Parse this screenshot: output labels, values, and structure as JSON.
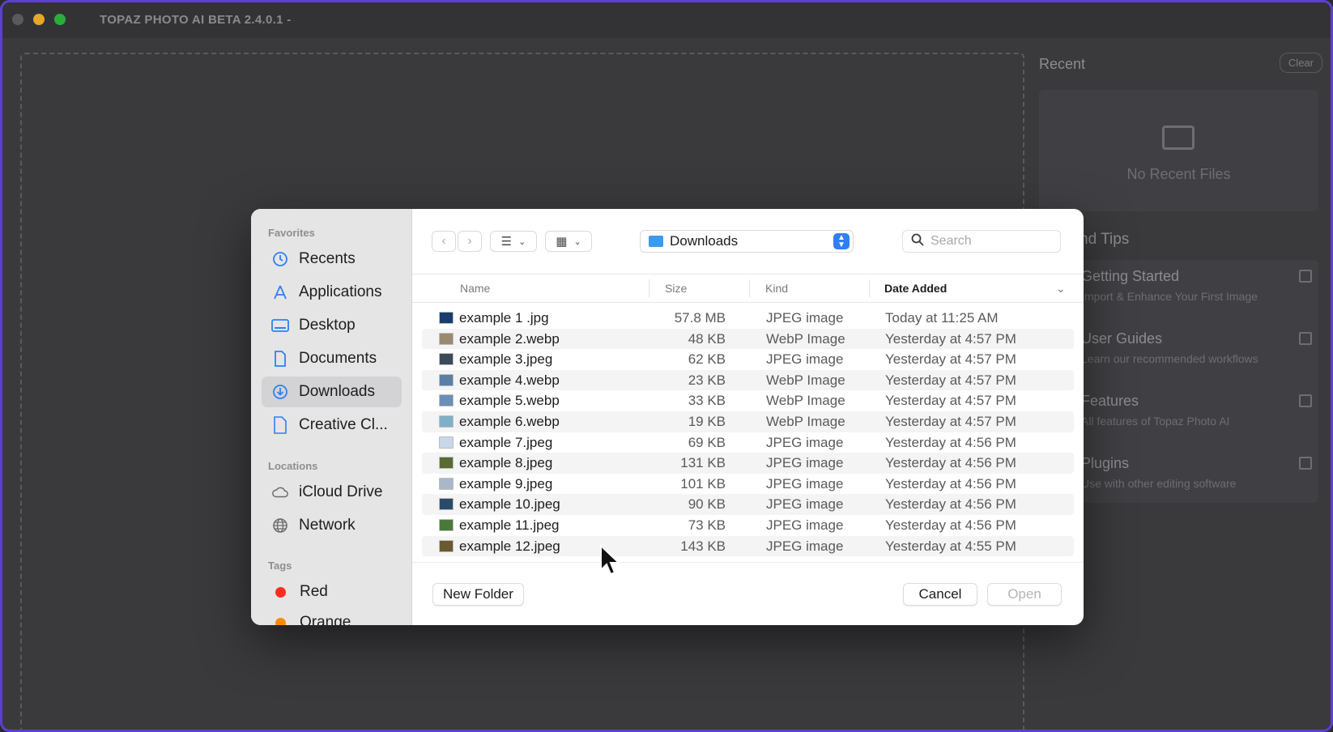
{
  "app": {
    "title": "TOPAZ PHOTO AI BETA 2.4.0.1 -",
    "recent": {
      "title": "Recent",
      "clear_label": "Clear",
      "empty_text": "No Recent Files"
    },
    "tips": {
      "title": "nd Tips",
      "items": [
        {
          "title": "Getting Started",
          "subtitle": "Import & Enhance Your First Image"
        },
        {
          "title": "User Guides",
          "subtitle": "Learn our recommended workflows"
        },
        {
          "title": "Features",
          "subtitle": "All features of Topaz Photo AI"
        },
        {
          "title": "Plugins",
          "subtitle": "Use with other editing software"
        }
      ]
    }
  },
  "dialog": {
    "sidebar": {
      "favorites_label": "Favorites",
      "favorites": [
        {
          "label": "Recents",
          "icon": "clock-icon"
        },
        {
          "label": "Applications",
          "icon": "applications-icon"
        },
        {
          "label": "Desktop",
          "icon": "desktop-icon"
        },
        {
          "label": "Documents",
          "icon": "document-icon"
        },
        {
          "label": "Downloads",
          "icon": "download-icon",
          "active": true
        },
        {
          "label": "Creative Cl...",
          "icon": "file-icon"
        }
      ],
      "locations_label": "Locations",
      "locations": [
        {
          "label": "iCloud Drive",
          "icon": "cloud-icon"
        },
        {
          "label": "Network",
          "icon": "globe-icon"
        }
      ],
      "tags_label": "Tags",
      "tags": [
        {
          "label": "Red",
          "color": "#ff2d20"
        },
        {
          "label": "Orange",
          "color": "#ff8a00"
        }
      ]
    },
    "toolbar": {
      "location": "Downloads",
      "search_placeholder": "Search"
    },
    "columns": {
      "name": "Name",
      "size": "Size",
      "kind": "Kind",
      "date": "Date Added"
    },
    "files": [
      {
        "name": "example 1 .jpg",
        "size": "57.8 MB",
        "kind": "JPEG image",
        "date": "Today at 11:25 AM"
      },
      {
        "name": "example 2.webp",
        "size": "48 KB",
        "kind": "WebP Image",
        "date": "Yesterday at 4:57 PM"
      },
      {
        "name": "example 3.jpeg",
        "size": "62 KB",
        "kind": "JPEG image",
        "date": "Yesterday at 4:57 PM"
      },
      {
        "name": "example 4.webp",
        "size": "23 KB",
        "kind": "WebP Image",
        "date": "Yesterday at 4:57 PM"
      },
      {
        "name": "example 5.webp",
        "size": "33 KB",
        "kind": "WebP Image",
        "date": "Yesterday at 4:57 PM"
      },
      {
        "name": "example 6.webp",
        "size": "19 KB",
        "kind": "WebP Image",
        "date": "Yesterday at 4:57 PM"
      },
      {
        "name": "example 7.jpeg",
        "size": "69 KB",
        "kind": "JPEG image",
        "date": "Yesterday at 4:56 PM"
      },
      {
        "name": "example 8.jpeg",
        "size": "131 KB",
        "kind": "JPEG image",
        "date": "Yesterday at 4:56 PM"
      },
      {
        "name": "example 9.jpeg",
        "size": "101 KB",
        "kind": "JPEG image",
        "date": "Yesterday at 4:56 PM"
      },
      {
        "name": "example 10.jpeg",
        "size": "90 KB",
        "kind": "JPEG image",
        "date": "Yesterday at 4:56 PM"
      },
      {
        "name": "example 11.jpeg",
        "size": "73 KB",
        "kind": "JPEG image",
        "date": "Yesterday at 4:56 PM"
      },
      {
        "name": "example 12.jpeg",
        "size": "143 KB",
        "kind": "JPEG image",
        "date": "Yesterday at 4:55 PM"
      }
    ],
    "footer": {
      "new_folder_label": "New Folder",
      "cancel_label": "Cancel",
      "open_label": "Open"
    }
  },
  "colors": {
    "accent": "#2f7ff5",
    "window_border": "#5d3fd3"
  }
}
